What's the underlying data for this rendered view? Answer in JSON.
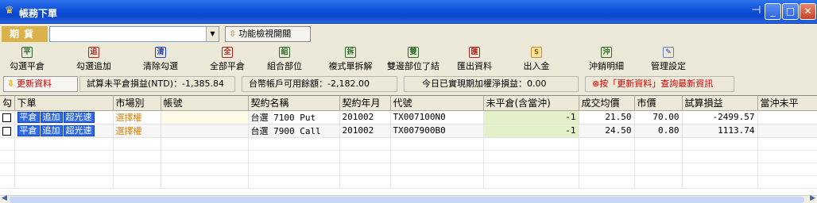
{
  "window": {
    "title": "帳務下單",
    "app_icon": "crown-icon",
    "pin_glyph": "⊣",
    "min_glyph": "_",
    "max_glyph": "□",
    "close_glyph": "✕"
  },
  "filter": {
    "label": "期貨",
    "select_value": "",
    "function_button": "功能檢視開關"
  },
  "toolbar": {
    "items": [
      {
        "label": "勾選平倉",
        "icon": "close-position-icon",
        "glyph": "平"
      },
      {
        "label": "勾選追加",
        "icon": "add-position-icon",
        "glyph": "追"
      },
      {
        "label": "清除勾選",
        "icon": "clear-check-icon",
        "glyph": "清"
      },
      {
        "label": "全部平倉",
        "icon": "close-all-icon",
        "glyph": "全"
      },
      {
        "label": "組合部位",
        "icon": "combine-icon",
        "glyph": "組"
      },
      {
        "label": "複式單拆解",
        "icon": "split-icon",
        "glyph": "拆"
      },
      {
        "label": "雙邊部位了結",
        "icon": "settle-icon",
        "glyph": "雙"
      },
      {
        "label": "匯出資料",
        "icon": "export-icon",
        "glyph": "匯"
      },
      {
        "label": "出入金",
        "icon": "money-icon",
        "glyph": "$"
      },
      {
        "label": "沖銷明細",
        "icon": "offset-detail-icon",
        "glyph": "沖"
      },
      {
        "label": "管理設定",
        "icon": "settings-icon",
        "glyph": "✎"
      }
    ]
  },
  "info": {
    "refresh_label": "更新資料",
    "unrealized_pl": "試算未平倉損益(NTD)：-1,385.84",
    "available_balance": "台幣帳戶可用餘額：-2,182.00",
    "realized_premium": "今日已實現期加權淨損益：0.00",
    "notice": "⊗按「更新資料」查詢最新資訊"
  },
  "table": {
    "headers": [
      "勾",
      "下單",
      "市場別",
      "帳號",
      "契約名稱",
      "契約年月",
      "代號",
      "未平倉(含當沖)",
      "成交均價",
      "市價",
      "試算損益",
      "當沖未平"
    ],
    "order_buttons": [
      "平倉",
      "追加",
      "超光速"
    ],
    "rows": [
      {
        "market": "選擇權",
        "account": "",
        "contract": "台選 7100 Put",
        "month": "201002",
        "code": "TX007100N0",
        "open": "-1",
        "avg_price": "21.50",
        "market_price": "70.00",
        "pl": "-2499.57",
        "daytrade": ""
      },
      {
        "market": "選擇權",
        "account": "",
        "contract": "台選 7900 Call",
        "month": "201002",
        "code": "TX007900B0",
        "open": "-1",
        "avg_price": "24.50",
        "market_price": "0.80",
        "pl": "1113.74",
        "daytrade": ""
      }
    ]
  },
  "colors": {
    "title_bar": "#0f4fd8",
    "filter_label": "#d9b24a",
    "order_button": "#2f6be6",
    "open_cell": "#e3f0c8",
    "market_text": "#e08000",
    "notice_text": "#d00000"
  }
}
